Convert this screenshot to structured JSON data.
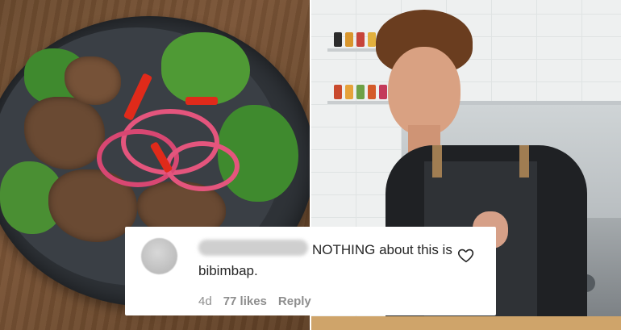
{
  "comment": {
    "text": "NOTHING about this is bibimbap.",
    "time": "4d",
    "likes": "77 likes",
    "reply_label": "Reply"
  },
  "icons": {
    "like": "heart-outline-icon",
    "avatar": "blurred-avatar"
  },
  "colors": {
    "text_primary": "#262626",
    "text_secondary": "#8e8e8e",
    "card_bg": "#ffffff"
  }
}
